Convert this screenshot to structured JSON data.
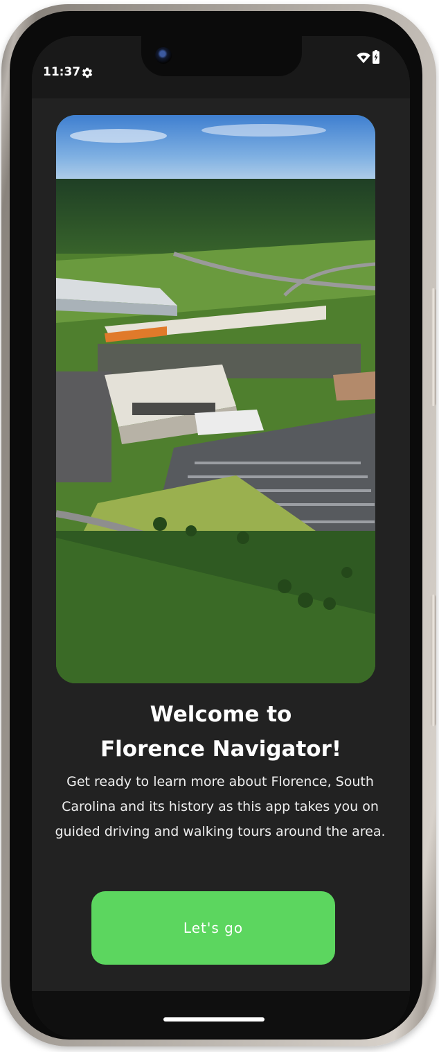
{
  "status_bar": {
    "time": "11:37",
    "icons": [
      "gear-icon",
      "wifi-icon",
      "battery-icon"
    ]
  },
  "hero_image": {
    "subject": "aerial photo"
  },
  "welcome": {
    "title_line1": "Welcome to",
    "title_line2": "Florence Navigator!",
    "description": "Get ready to learn more about Florence, South Carolina and its history as this app takes you on guided driving and walking tours around the area."
  },
  "actions": {
    "primary_label": "Let's go"
  },
  "colors": {
    "background": "#222222",
    "accent": "#5cd65f",
    "text": "#ffffff"
  }
}
